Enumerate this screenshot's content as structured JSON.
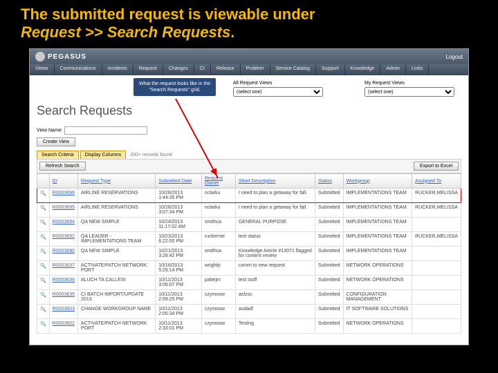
{
  "heading": {
    "line1": "The submitted request is viewable under",
    "line2": "Request >> Search Requests",
    "period": "."
  },
  "app": {
    "logo": "PEGASUS",
    "logout": "Logout"
  },
  "menu": [
    "Views",
    "Communications",
    "Incidents",
    "Request",
    "Changes",
    "CI",
    "Release",
    "Problem",
    "Service Catalog",
    "Support",
    "Knowledge",
    "Admin",
    "Links"
  ],
  "callout": {
    "l1": "What the request looks like in the",
    "l2": "\"Search Requests\" grid."
  },
  "viewsArea": {
    "all": {
      "label": "All Request Views",
      "sel": "(select one)"
    },
    "my": {
      "label": "My Request Views",
      "sel": "(select one)"
    }
  },
  "pageTitle": "Search Requests",
  "viewName": {
    "label": "View Name:",
    "btn": "Create View"
  },
  "tabs": {
    "t1": "Search Criteria",
    "t2": "Display Columns",
    "records": "200+ records found"
  },
  "toolbar": {
    "refresh": "Refresh Search",
    "export": "Export to Excel"
  },
  "cols": [
    "",
    "ID",
    "Request Type",
    "Submitted Date",
    "Request Owner",
    "Short Description",
    "Status",
    "Workgroup",
    "Assigned To"
  ],
  "rows": [
    {
      "id": "R0003696",
      "type": "AIRLINE RESERVATIONS",
      "date": "10/28/2013 1:44:35 PM",
      "owner": "nclarku",
      "desc": "I need to plan a getaway for fall.",
      "status": "Submitted",
      "wg": "IMPLEMENTATIONS TEAM",
      "asg": "RUCKER,MELISSA",
      "hl": true
    },
    {
      "id": "R0003695",
      "type": "AIRLINE RESERVATIONS",
      "date": "10/28/2013 3:07:34 PM",
      "owner": "nclarku",
      "desc": "I need to plan a getaway for fall.",
      "status": "Submitted",
      "wg": "IMPLEMENTATIONS TEAM",
      "asg": "RUCKER,MELISSA"
    },
    {
      "id": "R0003694",
      "type": "QA NEW SIMPLE",
      "date": "10/24/2013 11:17:02 AM",
      "owner": "smithca",
      "desc": "GENERAL PURPOSE",
      "status": "Submitted",
      "wg": "IMPLEMENTATIONS TEAM",
      "asg": ""
    },
    {
      "id": "R0003692",
      "type": "QA LEADER - IMPLEMENTATIONS TEAM",
      "date": "10/23/2013 6:22:00 PM",
      "owner": "ruckerme",
      "desc": "test status",
      "status": "Submitted",
      "wg": "IMPLEMENTATIONS TEAM",
      "asg": "RUCKER,MELISSA"
    },
    {
      "id": "R0003690",
      "type": "QA NEW SIMPLE",
      "date": "10/21/2013 3:28:42 PM",
      "owner": "smithca",
      "desc": "Knowledge Article #13071 flagged for content review",
      "status": "Submitted",
      "wg": "IMPLEMENTATIONS TEAM",
      "asg": ""
    },
    {
      "id": "R0003637",
      "type": "ACTIVATE/PATCH NETWORK PORT",
      "date": "10/16/2013 5:29:14 PM",
      "owner": "wrightjc",
      "desc": "comm to new request",
      "status": "Submitted",
      "wg": "NETWORK OPERATIONS",
      "asg": ""
    },
    {
      "id": "R0003636",
      "type": "ALUCH TA CALLESI",
      "date": "10/11/2013 3:08:07 PM",
      "owner": "pattejm",
      "desc": "test stuff",
      "status": "Submitted",
      "wg": "NETWORK OPERATIONS",
      "asg": ""
    },
    {
      "id": "R0003635",
      "type": "CI BATCH IMPORT/UPDATE 2013",
      "date": "10/11/2013 2:59:25 PM",
      "owner": "czymoow",
      "desc": "asfzsc",
      "status": "Submitted",
      "wg": "CONFIGURATION MANAGEMENT",
      "asg": ""
    },
    {
      "id": "R0003603",
      "type": "CHANGE WORKGROUP NAME",
      "date": "10/11/2013 2:05:34 PM",
      "owner": "czymoow",
      "desc": "asdadf",
      "status": "Submitted",
      "wg": "IT SOFTWARE SOLUTIONS",
      "asg": ""
    },
    {
      "id": "R0003602",
      "type": "ACTIVATE/PATCH NETWORK PORT",
      "date": "10/11/2013 2:33:01 PM",
      "owner": "czymoow",
      "desc": "Testing",
      "status": "Submitted",
      "wg": "NETWORK OPERATIONS",
      "asg": ""
    }
  ]
}
